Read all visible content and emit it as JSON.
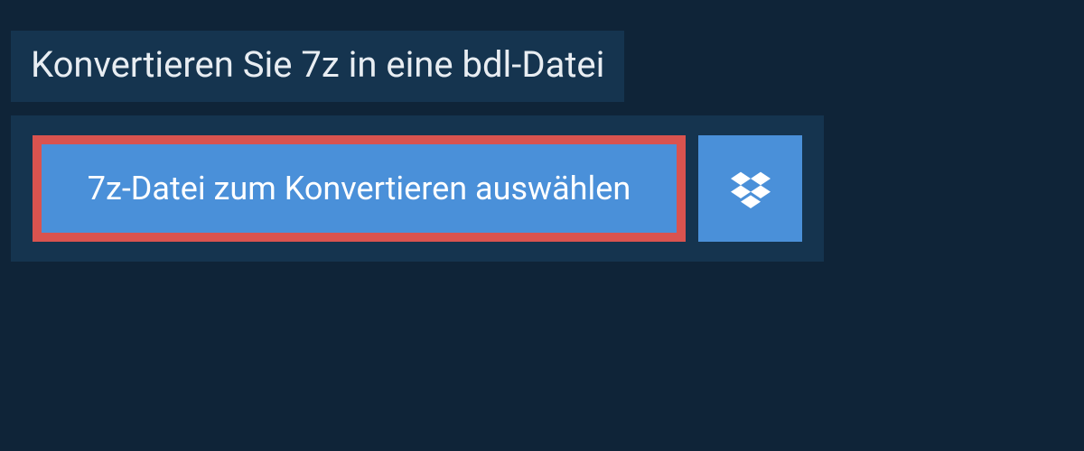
{
  "header": {
    "title": "Konvertieren Sie 7z in eine bdl-Datei"
  },
  "actions": {
    "select_file_label": "7z-Datei zum Konvertieren auswählen"
  },
  "colors": {
    "bg": "#0f2438",
    "panel": "#15344f",
    "button": "#4a90d9",
    "highlight_border": "#d9534f",
    "text_light": "#e8edf2",
    "text_white": "#ffffff"
  }
}
